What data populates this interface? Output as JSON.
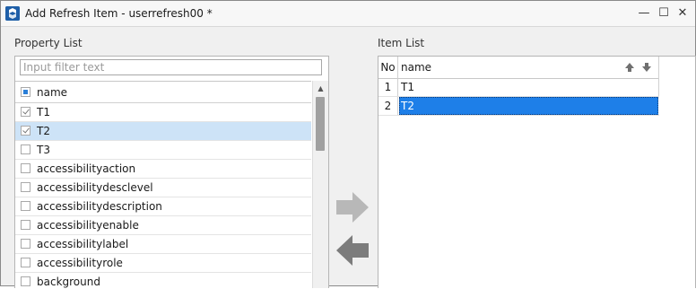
{
  "window": {
    "title": "Add Refresh Item - userrefresh00 *",
    "minimize_glyph": "—",
    "maximize_glyph": "☐",
    "close_glyph": "✕"
  },
  "property_list": {
    "label": "Property List",
    "filter_placeholder": "Input filter text",
    "header_label": "name",
    "rows": [
      {
        "label": "T1",
        "checked": true
      },
      {
        "label": "T2",
        "checked": true,
        "selected": true
      },
      {
        "label": "T3",
        "checked": false
      },
      {
        "label": "accessibilityaction",
        "checked": false
      },
      {
        "label": "accessibilitydesclevel",
        "checked": false
      },
      {
        "label": "accessibilitydescription",
        "checked": false
      },
      {
        "label": "accessibilityenable",
        "checked": false
      },
      {
        "label": "accessibilitylabel",
        "checked": false
      },
      {
        "label": "accessibilityrole",
        "checked": false
      },
      {
        "label": "background",
        "checked": false
      }
    ]
  },
  "item_list": {
    "label": "Item List",
    "col_no": "No",
    "col_name": "name",
    "rows": [
      {
        "no": "1",
        "name": "T1"
      },
      {
        "no": "2",
        "name": "T2",
        "selected": true
      }
    ]
  },
  "icons": {
    "add": "arrow-right-icon",
    "remove": "arrow-left-icon",
    "move_up": "arrow-up-icon",
    "move_down": "arrow-down-icon"
  },
  "colors": {
    "selection_blue": "#1e7fe8",
    "row_highlight": "#cde3f7",
    "checkbox_partial": "#2a7fd8"
  }
}
